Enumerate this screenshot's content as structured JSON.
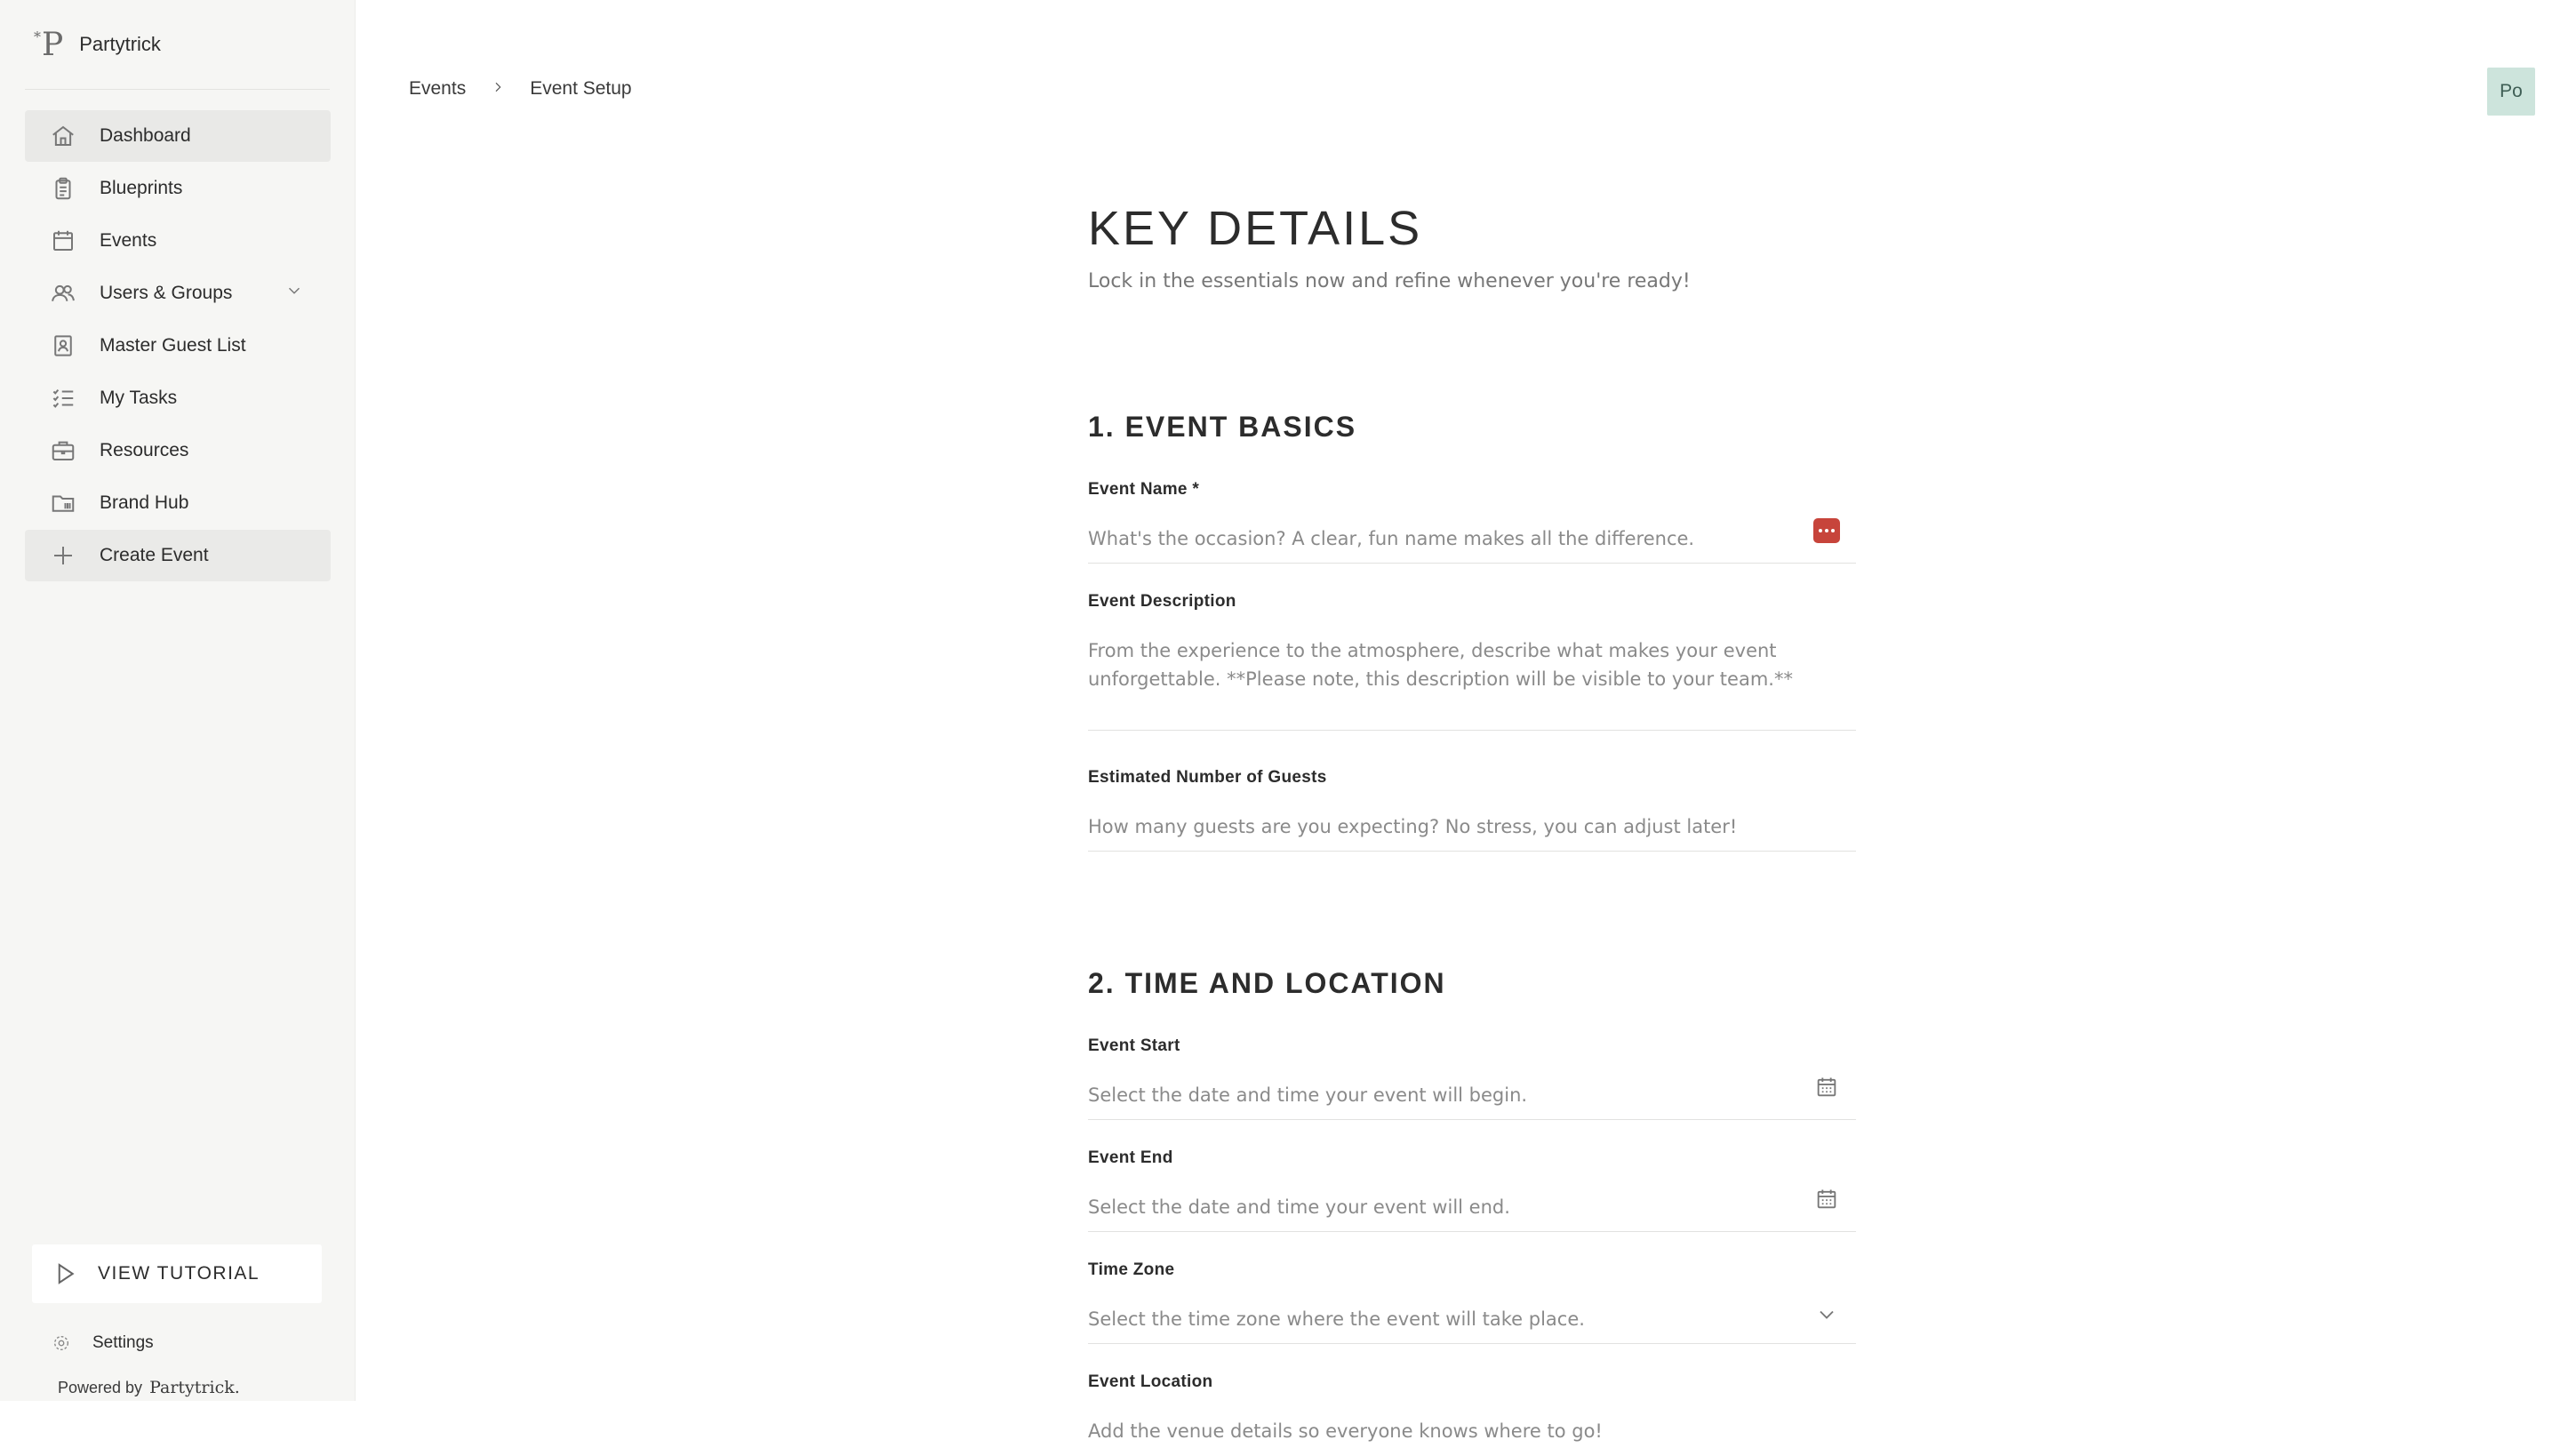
{
  "brand": {
    "name": "Partytrick",
    "logo_mark": "P",
    "logo_sup": "*"
  },
  "sidebar": {
    "items": [
      {
        "label": "Dashboard",
        "icon": "home-icon",
        "active": true
      },
      {
        "label": "Blueprints",
        "icon": "clipboard-icon"
      },
      {
        "label": "Events",
        "icon": "calendar-icon"
      },
      {
        "label": "Users & Groups",
        "icon": "users-icon",
        "expandable": true
      },
      {
        "label": "Master Guest List",
        "icon": "contact-book-icon"
      },
      {
        "label": "My Tasks",
        "icon": "tasks-list-icon"
      },
      {
        "label": "Resources",
        "icon": "briefcase-icon"
      },
      {
        "label": "Brand Hub",
        "icon": "folder-icon"
      },
      {
        "label": "Create Event",
        "icon": "plus-icon"
      }
    ],
    "tutorial_label": "VIEW TUTORIAL",
    "settings_label": "Settings",
    "powered_by": "Powered by",
    "powered_brand": "Partytrick."
  },
  "header": {
    "breadcrumb": [
      "Events",
      "Event Setup"
    ],
    "avatar_initials": "Po"
  },
  "main": {
    "title": "KEY DETAILS",
    "subtitle": "Lock in the essentials now and refine whenever you're ready!",
    "sections": [
      {
        "title": "1. EVENT BASICS",
        "fields": [
          {
            "label": "Event Name *",
            "placeholder": "What's the occasion? A clear, fun name makes all the difference."
          },
          {
            "label": "Event Description",
            "placeholder": "From the experience to the atmosphere, describe what makes your event unforgettable. **Please note, this description will be visible to your team.**"
          },
          {
            "label": "Estimated Number of Guests",
            "placeholder": "How many guests are you expecting? No stress, you can adjust later!"
          }
        ]
      },
      {
        "title": "2. TIME AND LOCATION",
        "fields": [
          {
            "label": "Event Start",
            "placeholder": "Select the date and time your event will begin."
          },
          {
            "label": "Event End",
            "placeholder": "Select the date and time your event will end."
          },
          {
            "label": "Time Zone",
            "placeholder": "Select the time zone where the event will take place."
          },
          {
            "label": "Event Location",
            "placeholder": "Add the venue details so everyone knows where to go!"
          }
        ]
      }
    ]
  },
  "colors": {
    "sidebar_bg": "#f6f6f4",
    "active_item": "#e9e9e7",
    "avatar_bg": "#cde4dc",
    "action_red": "#c7443b"
  }
}
